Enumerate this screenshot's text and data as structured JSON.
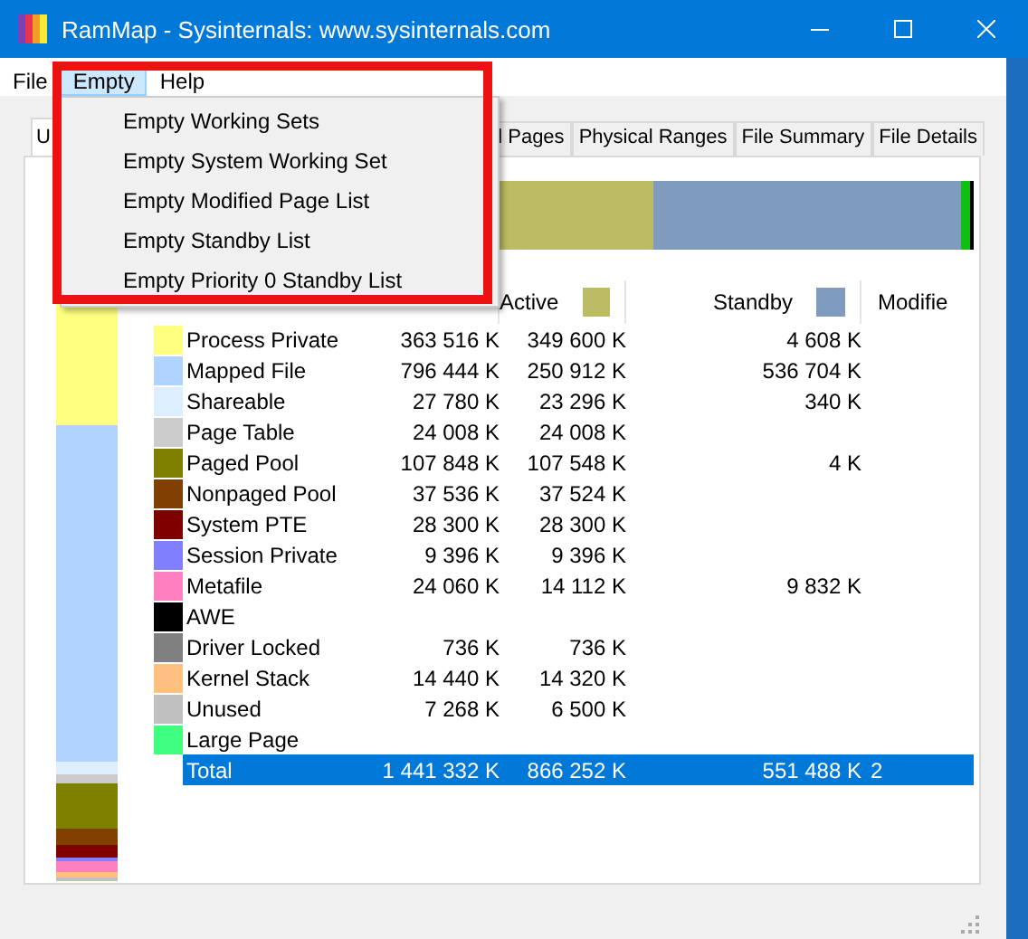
{
  "window": {
    "title": "RamMap - Sysinternals: www.sysinternals.com"
  },
  "menu_bar": [
    {
      "label": "File",
      "selected": false
    },
    {
      "label": "Empty",
      "selected": true
    },
    {
      "label": "Help",
      "selected": false
    }
  ],
  "menu": {
    "items": [
      "Empty Working Sets",
      "Empty System Working Set",
      "Empty Modified Page List",
      "Empty Standby List",
      "Empty Priority 0 Standby List"
    ]
  },
  "tabs": [
    {
      "label": "U",
      "selected": true
    },
    {
      "label": "l Pages",
      "selected": false
    },
    {
      "label": "Physical Ranges",
      "selected": false
    },
    {
      "label": "File Summary",
      "selected": false
    },
    {
      "label": "File Details",
      "selected": false
    }
  ],
  "table": {
    "columns": [
      {
        "label": "Active",
        "color": "#bcbc64"
      },
      {
        "label": "Standby",
        "color": "#7f9cbf"
      },
      {
        "label": "Modifie"
      }
    ],
    "rows": [
      {
        "name": "Process Private",
        "color": "#ffff80",
        "total": "363 516 K",
        "active": "349 600 K",
        "standby": "4 608 K"
      },
      {
        "name": "Mapped File",
        "color": "#b0d4ff",
        "total": "796 444 K",
        "active": "250 912 K",
        "standby": "536 704 K"
      },
      {
        "name": "Shareable",
        "color": "#ddeeff",
        "total": "27 780 K",
        "active": "23 296 K",
        "standby": "340 K"
      },
      {
        "name": "Page Table",
        "color": "#cccccc",
        "total": "24 008 K",
        "active": "24 008 K"
      },
      {
        "name": "Paged Pool",
        "color": "#808000",
        "total": "107 848 K",
        "active": "107 548 K",
        "standby": "4 K"
      },
      {
        "name": "Nonpaged Pool",
        "color": "#804000",
        "total": "37 536 K",
        "active": "37 524 K"
      },
      {
        "name": "System PTE",
        "color": "#800000",
        "total": "28 300 K",
        "active": "28 300 K"
      },
      {
        "name": "Session Private",
        "color": "#8080ff",
        "total": "9 396 K",
        "active": "9 396 K"
      },
      {
        "name": "Metafile",
        "color": "#ff80c0",
        "total": "24 060 K",
        "active": "14 112 K",
        "standby": "9 832 K"
      },
      {
        "name": "AWE",
        "color": "#000000"
      },
      {
        "name": "Driver Locked",
        "color": "#808080",
        "total": "736 K",
        "active": "736 K"
      },
      {
        "name": "Kernel Stack",
        "color": "#ffc080",
        "total": "14 440 K",
        "active": "14 320 K"
      },
      {
        "name": "Unused",
        "color": "#c0c0c0",
        "total": "7 268 K",
        "active": "6 500 K"
      },
      {
        "name": "Large Page",
        "color": "#40ff80"
      }
    ],
    "total_row": {
      "name": "Total",
      "total": "1 441 332 K",
      "active": "866 252 K",
      "standby": "551 488 K",
      "modified": "2",
      "selected": true
    }
  }
}
